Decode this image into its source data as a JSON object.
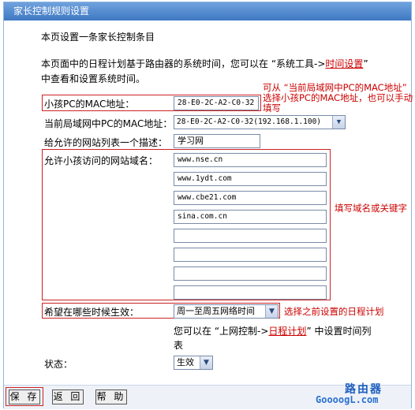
{
  "window": {
    "title": "家长控制规则设置"
  },
  "intro": {
    "heading": "本页设置一条家长控制条目",
    "desc_part1": "本页面中的日程计划基于路由器的系统时间，您可以在 “系统工具->",
    "desc_link": "时间设置",
    "desc_part2": "”",
    "desc_line2": "中查看和设置系统时间。"
  },
  "annotations": {
    "mac_note_line1": "可从 “当前局域网中PC的MAC地址”",
    "mac_note_line2": "选择小孩PC的MAC地址，也可以手动",
    "mac_note_line3": "填写",
    "domain_note": "填写域名或关键字",
    "schedule_note": "选择之前设置的日程计划"
  },
  "form": {
    "child_mac": {
      "label": "小孩PC的MAC地址：",
      "value": "28-E0-2C-A2-C0-32"
    },
    "lan_mac": {
      "label": "当前局域网中PC的MAC地址：",
      "value": "28-E0-2C-A2-C0-32(192.168.1.100)"
    },
    "description": {
      "label": "给允许的网站列表一个描述：",
      "value": "学习网"
    },
    "domains": {
      "label": "允许小孩访问的网站域名：",
      "values": [
        "www.nse.cn",
        "www.1ydt.com",
        "www.cbe21.com",
        "sina.com.cn",
        "",
        "",
        "",
        ""
      ]
    },
    "schedule": {
      "label": "希望在哪些时候生效：",
      "value": "周一至周五网络时间",
      "hint_part1": "您可以在 “上网控制->",
      "hint_link": "日程计划",
      "hint_part2": "” 中设置时间列",
      "hint_line2": "表"
    },
    "status": {
      "label": "状态：",
      "value": "生效"
    }
  },
  "buttons": {
    "save": "保 存",
    "back": "返 回",
    "help": "帮 助"
  },
  "watermark": {
    "line1": "路由器",
    "line2": "GoooogL.com"
  }
}
